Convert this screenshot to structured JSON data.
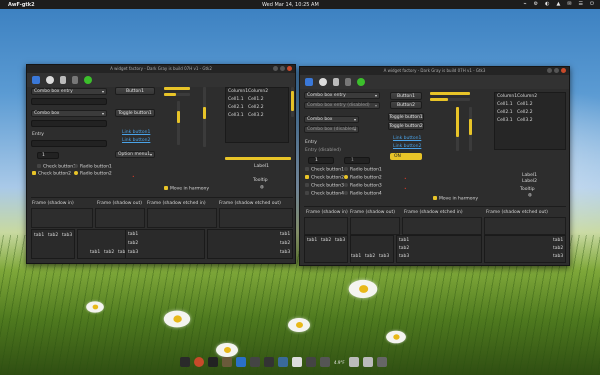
{
  "panel": {
    "app": "AwF-gtk2",
    "clock": "Wed Mar 14, 10:25 AM",
    "tray": [
      "⌁",
      "⚙",
      "◐",
      "▲",
      "✉",
      "☰",
      "⏻"
    ]
  },
  "colors": {
    "accent": "#e8c428",
    "panel": "#1d1d1d",
    "window": "#2d2d2d",
    "link": "#4aa3e8",
    "green": "#3cbf2c"
  },
  "win1": {
    "title": "A widget factory - Dark Gray is build 07H v1 - Gtk2",
    "combo_entry": "Combo box entry",
    "combo": "Combo box",
    "entry_label": "Entry",
    "spin": "1",
    "button1": "Button1",
    "toggle1": "Toggle button1",
    "link1": "Link button1",
    "link2": "Link button2",
    "option": "Option menu1",
    "cols": [
      "Column1",
      "Column2"
    ],
    "cells": [
      [
        "Cell1.1",
        "Cell1.2"
      ],
      [
        "Cell2.1",
        "Cell2.2"
      ],
      [
        "Cell3.1",
        "Cell3.2"
      ]
    ],
    "checks": [
      "Check button1",
      "Check button2"
    ],
    "radios": [
      "Radio button1",
      "Radio button2"
    ],
    "move": "Move in harmony",
    "label1": "Label1",
    "tooltip": "Tooltip",
    "frames": [
      "Frame (shadow in)",
      "Frame (shadow out)",
      "Frame (shadow etched in)",
      "Frame (shadow etched out)"
    ],
    "tabs": [
      "tab1",
      "tab2",
      "tab3"
    ]
  },
  "win2": {
    "title": "A widget factory - Dark Gray is build 07H v1 - Gtk3",
    "combo_entry": "Combo box entry",
    "combo_entry_dis": "Combo box entry (disabled)",
    "combo": "Combo box",
    "combo_dis": "Combo box (disabled)",
    "entry_label": "Entry",
    "entry_dis": "Entry (disabled)",
    "spin": "1",
    "on": "ON",
    "button1": "Button1",
    "button2": "Button2",
    "toggle1": "Toggle button1",
    "toggle2": "Toggle button2",
    "link1": "Link button1",
    "link2": "Link button2",
    "cols": [
      "Column1",
      "Column2"
    ],
    "cells": [
      [
        "Cell1.1",
        "Cell1.2"
      ],
      [
        "Cell2.1",
        "Cell2.2"
      ],
      [
        "Cell3.1",
        "Cell3.2"
      ]
    ],
    "checks": [
      "Check button1",
      "Check button2",
      "Check button3",
      "Check button4"
    ],
    "radios": [
      "Radio button1",
      "Radio button2",
      "Radio button3",
      "Radio button4"
    ],
    "move": "Move in harmony",
    "label1": "Label1",
    "label2": "Label2",
    "tooltip": "Tooltip",
    "frames": [
      "Frame (shadow in)",
      "Frame (shadow out)",
      "Frame (shadow etched in)",
      "Frame (shadow etched out)"
    ],
    "tabs": [
      "tab1",
      "tab2",
      "tab3"
    ]
  },
  "dock": {
    "label": "4.9°F"
  }
}
